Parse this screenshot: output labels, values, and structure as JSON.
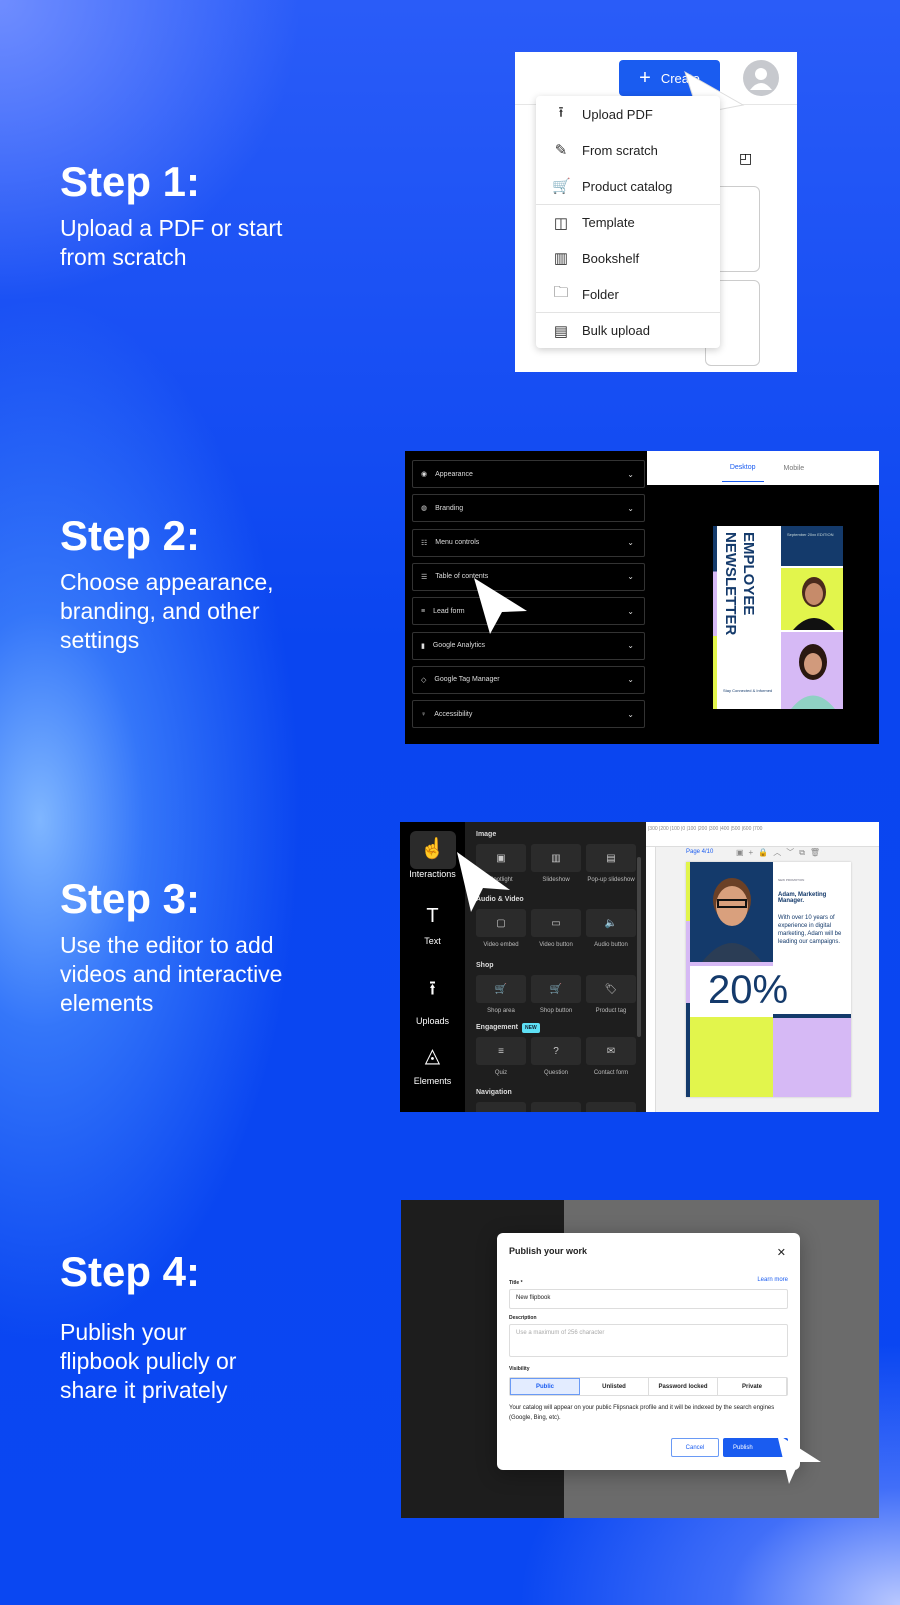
{
  "steps": [
    {
      "title": "Step 1:",
      "desc": "Upload a PDF or start from scratch"
    },
    {
      "title": "Step 2:",
      "desc": "Choose appearance, branding, and other settings"
    },
    {
      "title": "Step 3:",
      "desc": "Use the editor to add videos and interactive elements"
    },
    {
      "title": "Step 4:",
      "desc": "Publish your flipbook pulicly or share it privately"
    }
  ],
  "step1": {
    "create_label": "Create",
    "menu": [
      {
        "label": "Upload PDF",
        "icon": "upload-icon",
        "glyph": "⭱"
      },
      {
        "label": "From scratch",
        "icon": "magic-brush-icon",
        "glyph": "✎"
      },
      {
        "label": "Product catalog",
        "icon": "cart-icon",
        "glyph": "🛒"
      },
      {
        "label": "Template",
        "icon": "template-icon",
        "glyph": "◫"
      },
      {
        "label": "Bookshelf",
        "icon": "bookshelf-icon",
        "glyph": "▥"
      },
      {
        "label": "Folder",
        "icon": "folder-icon",
        "glyph": "🗀"
      },
      {
        "label": "Bulk upload",
        "icon": "archive-icon",
        "glyph": "▤"
      }
    ]
  },
  "step2": {
    "settings": [
      {
        "label": "Appearance",
        "glyph": "◉"
      },
      {
        "label": "Branding",
        "glyph": "◍"
      },
      {
        "label": "Menu controls",
        "glyph": "☷"
      },
      {
        "label": "Table of contents",
        "glyph": "☰"
      },
      {
        "label": "Lead form",
        "glyph": "≡"
      },
      {
        "label": "Google Analytics",
        "glyph": "▮"
      },
      {
        "label": "Google Tag Manager",
        "glyph": "◇"
      },
      {
        "label": "Accessibility",
        "glyph": "♀"
      }
    ],
    "tabs": {
      "desktop": "Desktop",
      "mobile": "Mobile"
    },
    "preview": {
      "title1": "EMPLOYEE",
      "title2": "NEWSLETTER",
      "edition": "September 20xx EDITION",
      "footer": "Stay Connected & Informed"
    }
  },
  "step3": {
    "rail": [
      {
        "label": "Interactions",
        "glyph": "☝"
      },
      {
        "label": "Text",
        "glyph": "T"
      },
      {
        "label": "Uploads",
        "glyph": "⭱"
      },
      {
        "label": "Elements",
        "glyph": "◬"
      }
    ],
    "sections": [
      "Image",
      "Audio & Video",
      "Shop",
      "Engagement",
      "Navigation"
    ],
    "new_badge": "NEW",
    "tiles": [
      [
        "Spotlight",
        "Slideshow",
        "Pop-up slideshow"
      ],
      [
        "Video embed",
        "Video button",
        "Audio button"
      ],
      [
        "Shop area",
        "Shop button",
        "Product tag"
      ],
      [
        "Quiz",
        "Question",
        "Contact form"
      ]
    ],
    "page_label": "Page 4/10",
    "doc": {
      "kicker": "NEW PROMOTION",
      "name": "Adam, Marketing Manager.",
      "bio": "With over 10 years of experience in digital marketing, Adam will be leading our campaigns.",
      "big": "20%"
    }
  },
  "step4": {
    "modal": {
      "title": "Publish your work",
      "title_label": "Title *",
      "learn_more": "Learn more",
      "title_value": "New flipbook",
      "description_label": "Description",
      "description_placeholder": "Use a maximum of 256 character",
      "visibility_label": "Visibility",
      "options": [
        "Public",
        "Unlisted",
        "Password locked",
        "Private"
      ],
      "selected": "Public",
      "note": "Your catalog will appear on your public Flipsnack profile and it will be indexed by the search engines (Google, Bing, etc).",
      "cancel": "Cancel",
      "publish": "Publish"
    }
  },
  "colors": {
    "accent": "#1a5cf0",
    "navy": "#143a6b",
    "lime": "#e2f54c",
    "lavender": "#d6b9f5"
  }
}
